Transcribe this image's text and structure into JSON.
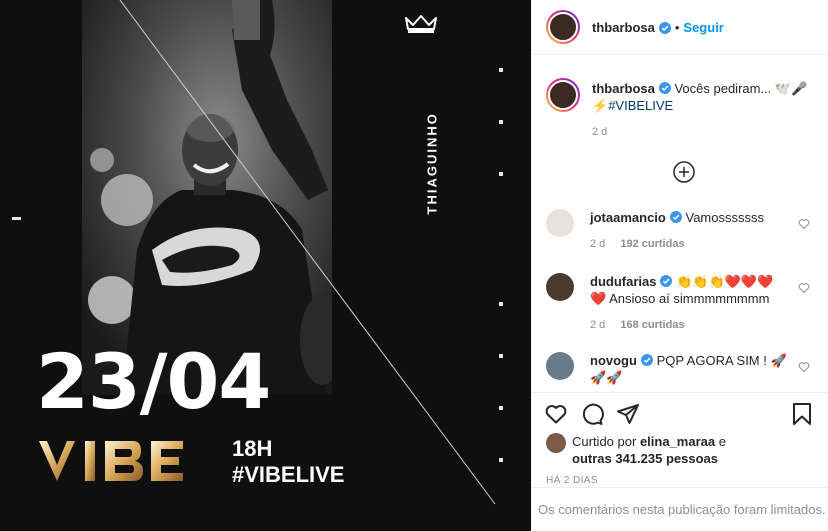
{
  "post": {
    "artist_name_vertical": "THIAGUINHO",
    "date": "23/04",
    "logo_text": "VIBE",
    "time": "18H",
    "hashtag": "#VIBELIVE"
  },
  "header": {
    "username": "thbarbosa",
    "separator": "•",
    "follow_label": "Seguir"
  },
  "caption": {
    "username": "thbarbosa",
    "text": "Vocês pediram... 🕊️🎤",
    "line2_emoji": "⚡",
    "hashtag": "#VIBELIVE",
    "time": "2 d"
  },
  "comments": [
    {
      "username": "jotaamancio",
      "text": "Vamosssssss",
      "time": "2 d",
      "likes": "192 curtidas"
    },
    {
      "username": "dudufarias",
      "text": "👏👏👏❤️❤️❤️",
      "text2": "❤️ Ansioso aí simmmmmmmm",
      "time": "2 d",
      "likes": "168 curtidas"
    },
    {
      "username": "novogu",
      "text": "PQP AGORA SIM ! 🚀",
      "text2": "🚀🚀"
    }
  ],
  "likes_line": {
    "prefix": "Curtido por",
    "user": "elina_maraa",
    "joiner": "e",
    "others": "outras 341.235 pessoas"
  },
  "post_age": "HÁ 2 DIAS",
  "limited_comments": "Os comentários nesta publicação foram limitados.",
  "colors": {
    "accent": "#0095f6",
    "verified": "#3897f0",
    "post_background": "#0f0f10"
  }
}
